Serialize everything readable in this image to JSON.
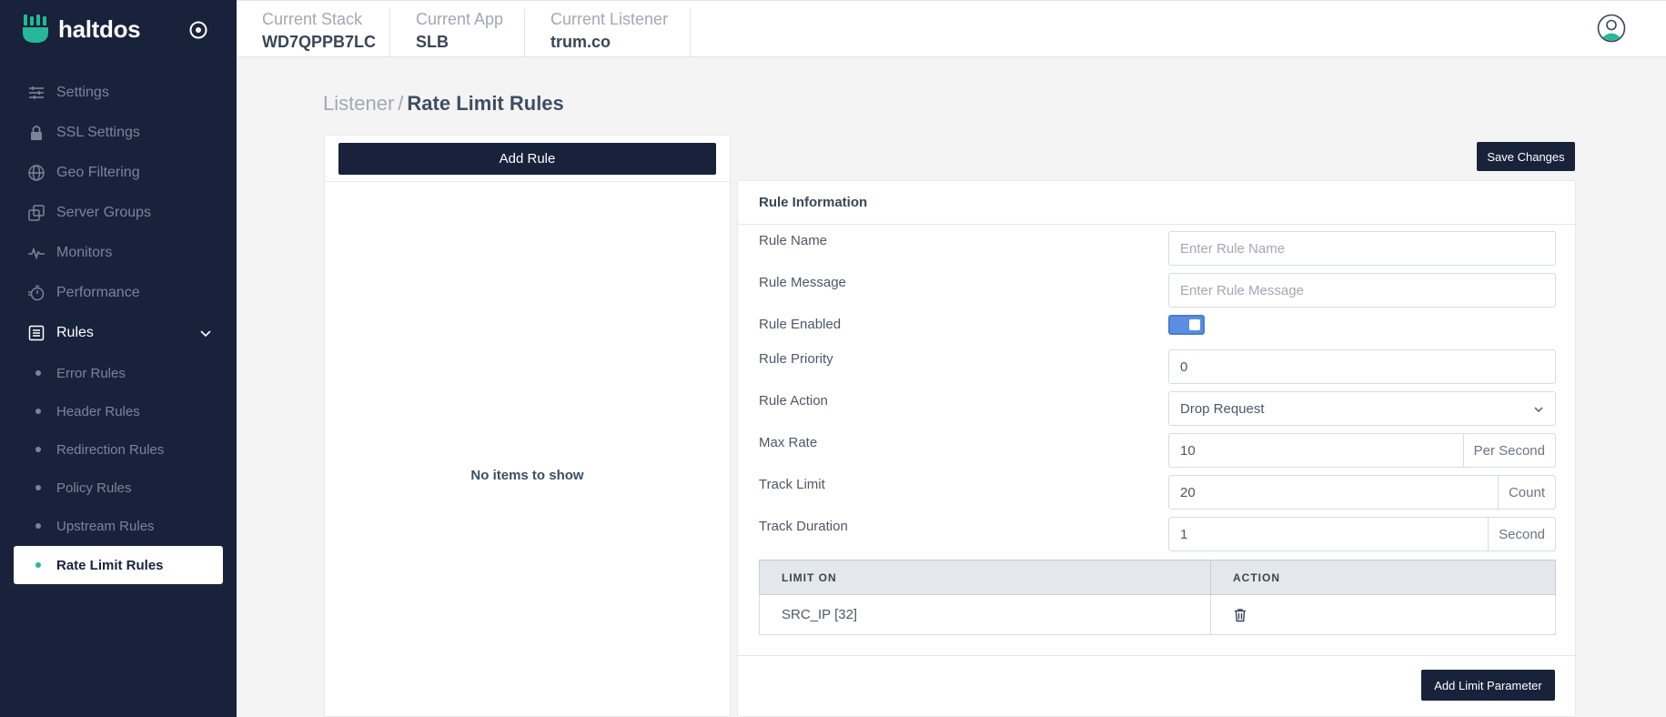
{
  "brand": {
    "name": "haltdos",
    "logo_icon": "haltdos-logo-icon",
    "accent_color": "#25b89a"
  },
  "header": {
    "stack_label": "Current Stack",
    "stack_value": "WD7QPPB7LC",
    "app_label": "Current App",
    "app_value": "SLB",
    "listener_label": "Current Listener",
    "listener_value": "trum.co"
  },
  "sidebar": {
    "items": [
      {
        "label": "Settings",
        "icon": "sliders-icon"
      },
      {
        "label": "SSL Settings",
        "icon": "lock-icon"
      },
      {
        "label": "Geo Filtering",
        "icon": "globe-icon"
      },
      {
        "label": "Server Groups",
        "icon": "server-groups-icon"
      },
      {
        "label": "Monitors",
        "icon": "pulse-icon"
      },
      {
        "label": "Performance",
        "icon": "stopwatch-icon"
      },
      {
        "label": "Rules",
        "icon": "list-icon"
      }
    ],
    "rules_children": [
      {
        "label": "Error Rules"
      },
      {
        "label": "Header Rules"
      },
      {
        "label": "Redirection Rules"
      },
      {
        "label": "Policy Rules"
      },
      {
        "label": "Upstream Rules"
      },
      {
        "label": "Rate Limit Rules"
      }
    ],
    "selected": "Rate Limit Rules"
  },
  "breadcrumb": {
    "parent": "Listener",
    "separator": "/",
    "current": "Rate Limit Rules"
  },
  "rules_list": {
    "add_button": "Add Rule",
    "empty_message": "No items to show"
  },
  "save_button": "Save Changes",
  "rule_form": {
    "title": "Rule Information",
    "rule_name": {
      "label": "Rule Name",
      "value": "",
      "placeholder": "Enter Rule Name"
    },
    "rule_message": {
      "label": "Rule Message",
      "value": "",
      "placeholder": "Enter Rule Message"
    },
    "rule_enabled": {
      "label": "Rule Enabled",
      "value": true
    },
    "rule_priority": {
      "label": "Rule Priority",
      "value": "0"
    },
    "rule_action": {
      "label": "Rule Action",
      "value": "Drop Request"
    },
    "max_rate": {
      "label": "Max Rate",
      "value": "10",
      "unit": "Per Second"
    },
    "track_limit": {
      "label": "Track Limit",
      "value": "20",
      "unit": "Count"
    },
    "track_duration": {
      "label": "Track Duration",
      "value": "1",
      "unit": "Second"
    }
  },
  "limit_table": {
    "columns": [
      "LIMIT ON",
      "ACTION"
    ],
    "rows": [
      {
        "limit_on": "SRC_IP [32]",
        "action_icon": "trash-icon"
      }
    ]
  },
  "add_limit_button": "Add Limit Parameter",
  "colors": {
    "sidebar_bg": "#18223a",
    "toggle_on": "#5b8de0",
    "button_bg": "#18223a"
  }
}
